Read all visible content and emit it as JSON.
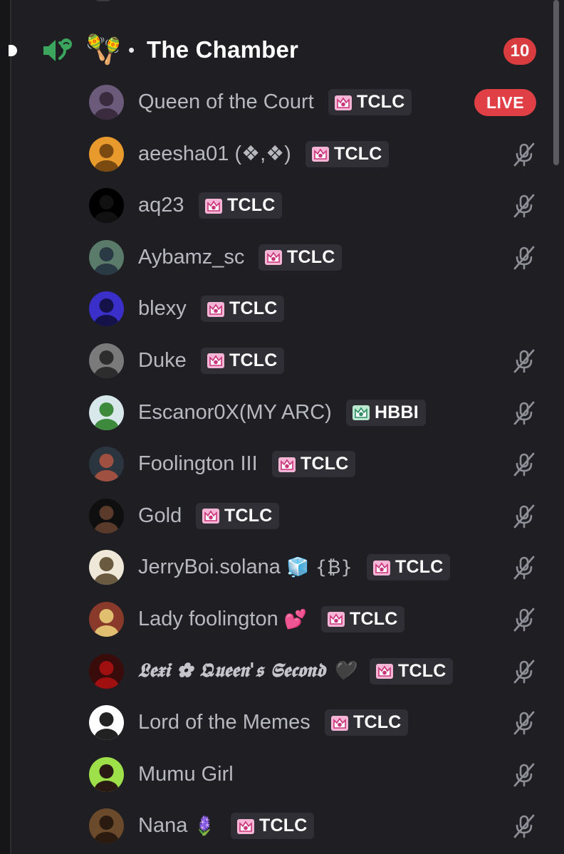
{
  "channel": {
    "name": "The Chamber",
    "emoji": "🪇",
    "separator": "•",
    "member_count": "10",
    "accent_color": "#3ba55d"
  },
  "colors": {
    "background": "#1f1f23",
    "badge_red": "#d83c3e",
    "tag_bg": "#2f2f35",
    "muted_text": "#b8b9bf"
  },
  "members": [
    {
      "name": "Queen of the Court",
      "tag": "TCLC",
      "tag_icon": "tclc-crown-icon",
      "status": "live",
      "status_label": "LIVE"
    },
    {
      "name": "aeesha01 (❖,❖)",
      "tag": "TCLC",
      "tag_icon": "tclc-crown-icon",
      "status": "muted"
    },
    {
      "name": "aq23",
      "tag": "TCLC",
      "tag_icon": "tclc-crown-icon",
      "status": "muted"
    },
    {
      "name": "Aybamz_sc",
      "tag": "TCLC",
      "tag_icon": "tclc-crown-icon",
      "status": "muted"
    },
    {
      "name": "blexy",
      "tag": "TCLC",
      "tag_icon": "tclc-crown-icon",
      "status": "none"
    },
    {
      "name": "Duke",
      "tag": "TCLC",
      "tag_icon": "tclc-crown-icon",
      "status": "muted"
    },
    {
      "name": "Escanor0X(MY ARC)",
      "tag": "HBBI",
      "tag_icon": "hbbi-crown-icon",
      "status": "muted"
    },
    {
      "name": "Foolington III",
      "tag": "TCLC",
      "tag_icon": "tclc-crown-icon",
      "status": "muted"
    },
    {
      "name": "Gold",
      "tag": "TCLC",
      "tag_icon": "tclc-crown-icon",
      "status": "muted"
    },
    {
      "name": "JerryBoi.solana",
      "name_suffix": "🧊 {₿}",
      "tag": "TCLC",
      "tag_icon": "tclc-crown-icon",
      "status": "muted"
    },
    {
      "name": "Lady foolington",
      "name_suffix": "💕",
      "tag": "TCLC",
      "tag_icon": "tclc-crown-icon",
      "status": "muted"
    },
    {
      "name": "𝕷𝖊𝖝𝖎 ✿ 𝕼𝖚𝖊𝖊𝖓'𝖘 𝕾𝖊𝖈𝖔𝖓𝖉",
      "name_suffix": "🖤",
      "tag": "TCLC",
      "tag_icon": "tclc-crown-icon",
      "status": "muted",
      "fancy": true
    },
    {
      "name": "Lord of the Memes",
      "tag": "TCLC",
      "tag_icon": "tclc-crown-icon",
      "status": "muted"
    },
    {
      "name": "Mumu Girl",
      "tag": "",
      "status": "muted"
    },
    {
      "name": "Nana",
      "name_suffix": "🪻",
      "tag": "TCLC",
      "tag_icon": "tclc-crown-icon",
      "status": "muted"
    }
  ]
}
